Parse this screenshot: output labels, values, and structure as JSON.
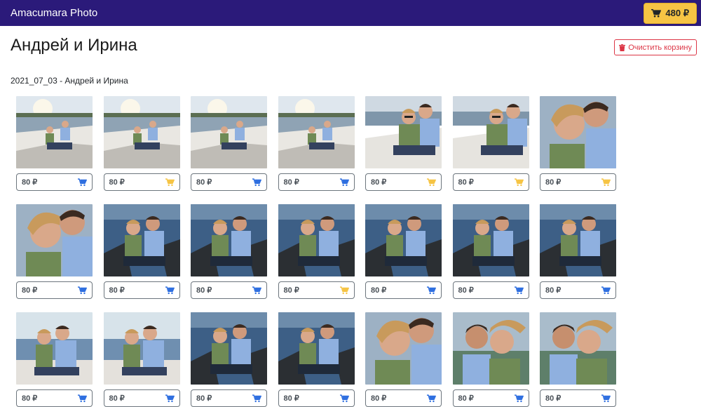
{
  "header": {
    "brand": "Amacumara Photo",
    "cart_total": "480 ₽"
  },
  "page": {
    "title": "Андрей и Ирина",
    "clear_cart_label": "Очистить корзину",
    "album_title": "2021_07_03 - Андрей и Ирина"
  },
  "colors": {
    "navbar": "#2b1a7a",
    "cart_button": "#f6c444",
    "in_cart_icon": "#f6c444",
    "add_icon": "#2f6fe0",
    "danger": "#dc3545"
  },
  "photos": [
    {
      "price": "80 ₽",
      "in_cart": false,
      "scene": "wide-boat-sunset"
    },
    {
      "price": "80 ₽",
      "in_cart": true,
      "scene": "wide-boat-sunset"
    },
    {
      "price": "80 ₽",
      "in_cart": false,
      "scene": "wide-boat-sunset"
    },
    {
      "price": "80 ₽",
      "in_cart": false,
      "scene": "wide-boat-sunset"
    },
    {
      "price": "80 ₽",
      "in_cart": true,
      "scene": "close-boat-sunglasses"
    },
    {
      "price": "80 ₽",
      "in_cart": true,
      "scene": "close-boat-sunglasses"
    },
    {
      "price": "80 ₽",
      "in_cart": true,
      "scene": "portrait-close"
    },
    {
      "price": "80 ₽",
      "in_cart": false,
      "scene": "portrait-close"
    },
    {
      "price": "80 ₽",
      "in_cart": false,
      "scene": "boat-deck-water"
    },
    {
      "price": "80 ₽",
      "in_cart": false,
      "scene": "boat-deck-water"
    },
    {
      "price": "80 ₽",
      "in_cart": true,
      "scene": "boat-deck-water"
    },
    {
      "price": "80 ₽",
      "in_cart": false,
      "scene": "boat-deck-water"
    },
    {
      "price": "80 ₽",
      "in_cart": false,
      "scene": "boat-deck-water"
    },
    {
      "price": "80 ₽",
      "in_cart": false,
      "scene": "boat-deck-water"
    },
    {
      "price": "80 ₽",
      "in_cart": false,
      "scene": "couple-water-sun"
    },
    {
      "price": "80 ₽",
      "in_cart": false,
      "scene": "couple-water-sun"
    },
    {
      "price": "80 ₽",
      "in_cart": false,
      "scene": "boat-deck-water"
    },
    {
      "price": "80 ₽",
      "in_cart": false,
      "scene": "boat-deck-water"
    },
    {
      "price": "80 ₽",
      "in_cart": false,
      "scene": "portrait-close"
    },
    {
      "price": "80 ₽",
      "in_cart": false,
      "scene": "portrait-wind"
    },
    {
      "price": "80 ₽",
      "in_cart": false,
      "scene": "portrait-wind"
    }
  ]
}
